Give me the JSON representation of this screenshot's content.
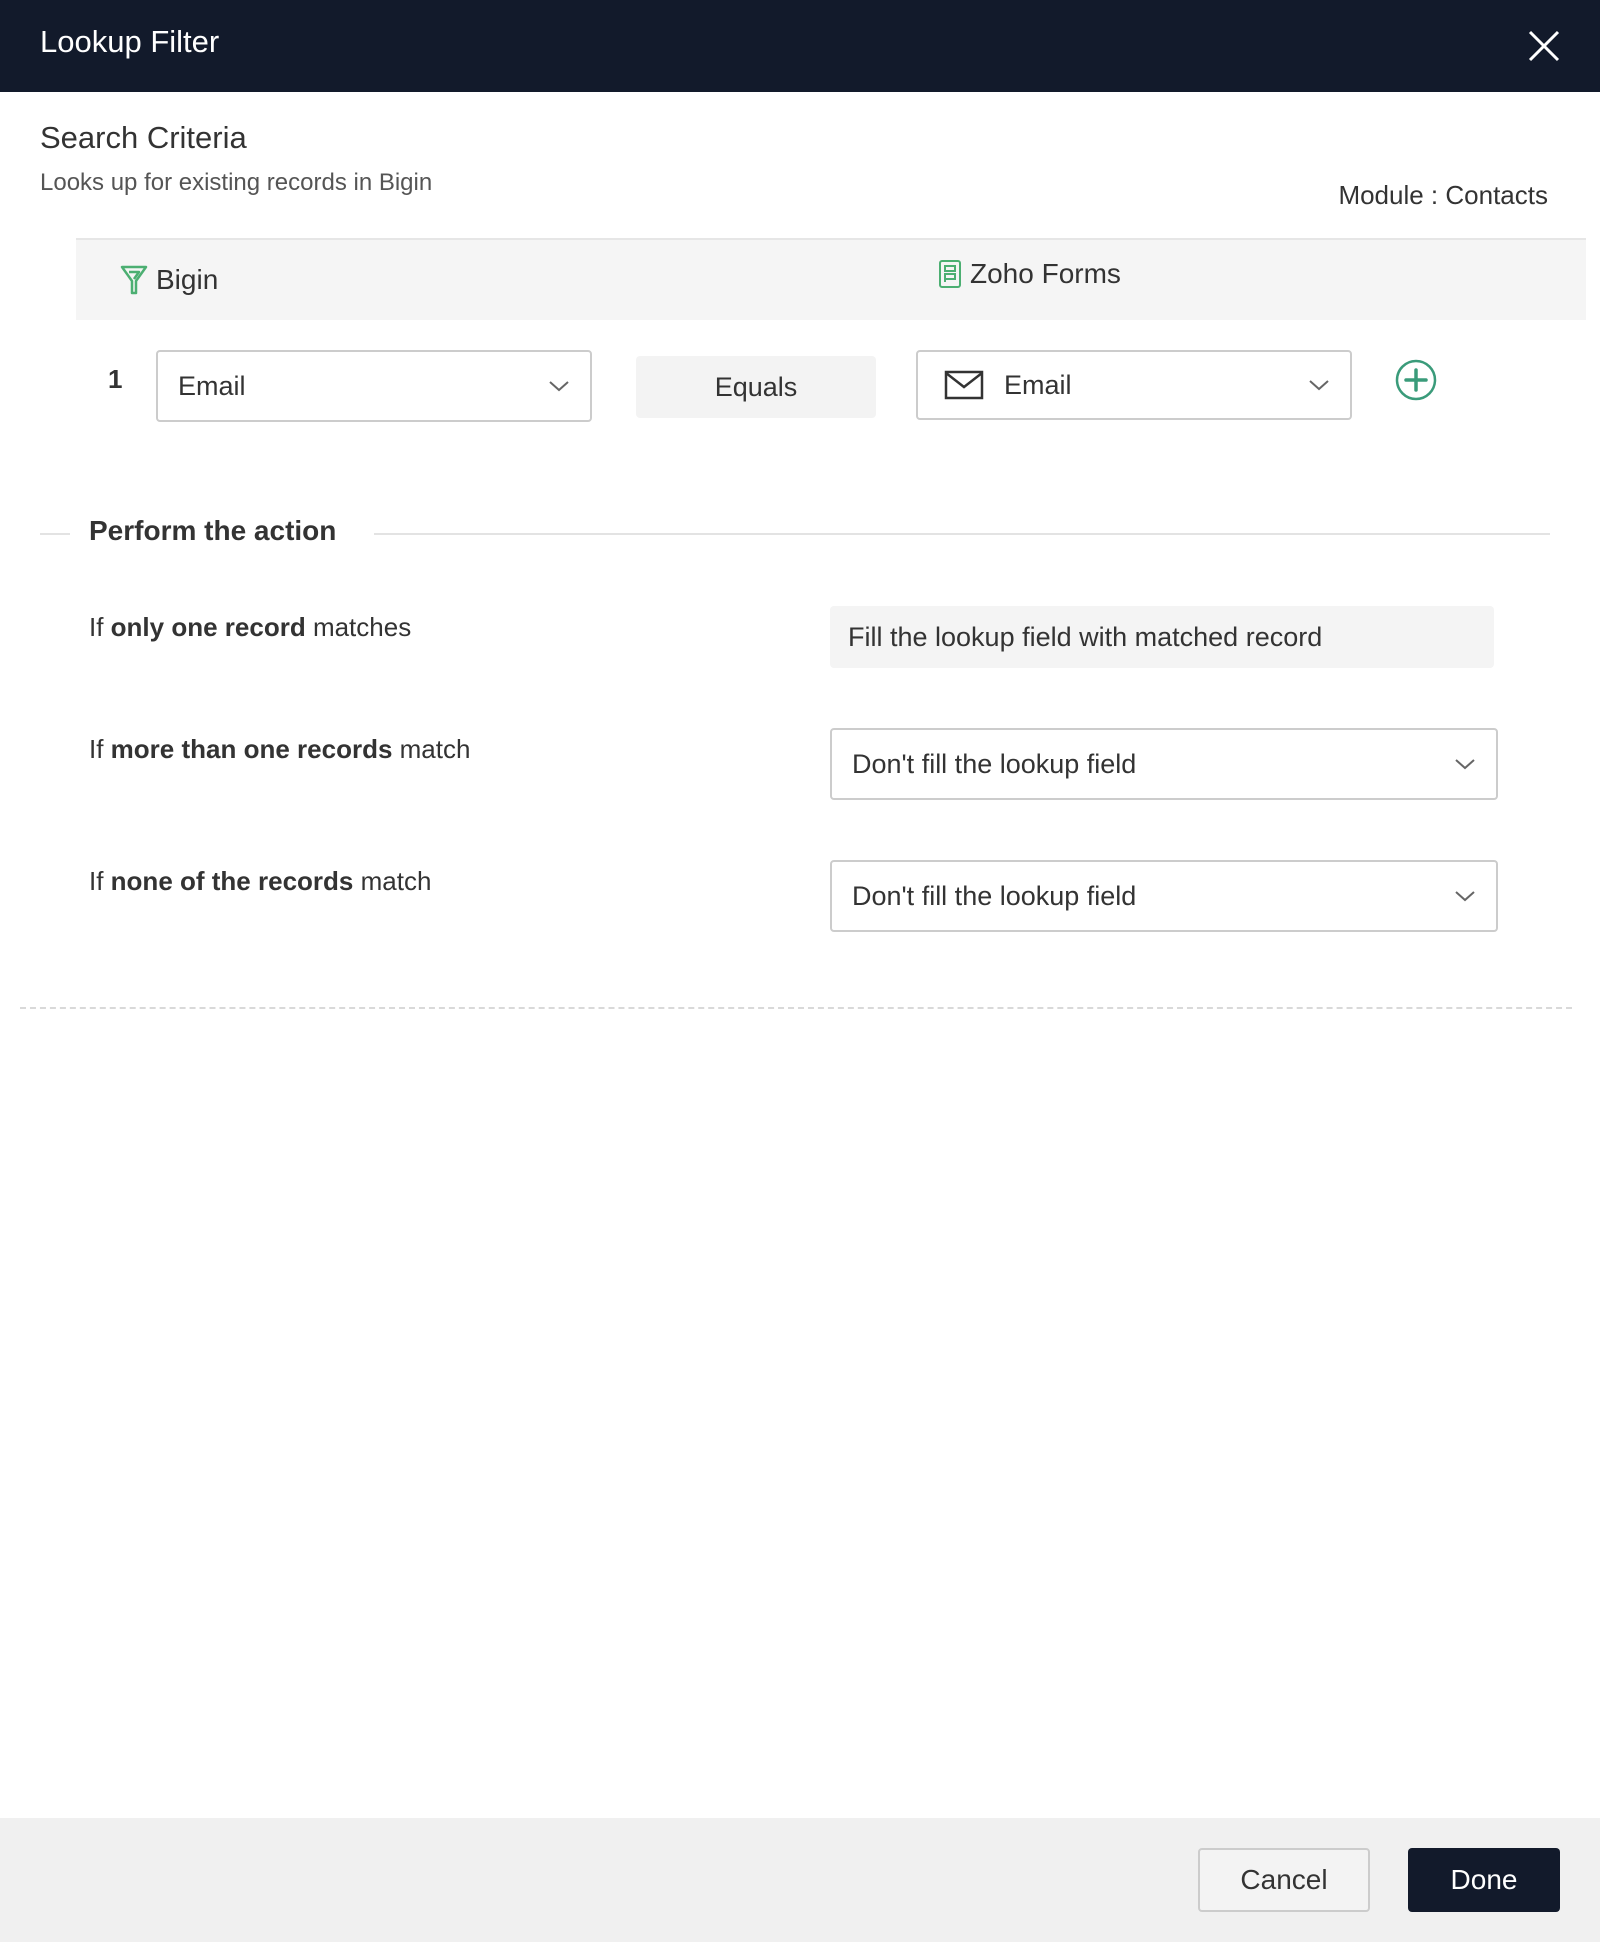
{
  "dialog": {
    "title": "Lookup Filter",
    "close_icon": "close-icon"
  },
  "search_criteria": {
    "title": "Search Criteria",
    "subtitle": "Looks up for existing records in Bigin",
    "module_label": "Module : Contacts"
  },
  "mapping": {
    "columns": [
      {
        "label": "Bigin",
        "icon": "bigin-logo-icon"
      },
      {
        "label": "Zoho Forms",
        "icon": "zoho-forms-icon"
      }
    ],
    "rows": [
      {
        "index": "1",
        "bigin_field": "Email",
        "operator": "Equals",
        "forms_field": "Email",
        "forms_field_icon": "envelope-icon"
      }
    ],
    "add_icon": "plus-circle-icon"
  },
  "action": {
    "title": "Perform the action",
    "conditions": [
      {
        "prefix": "If ",
        "bold": "only one record",
        "suffix": " matches",
        "value": "Fill the lookup field with matched record",
        "editable": false
      },
      {
        "prefix": "If ",
        "bold": "more than one records",
        "suffix": " match",
        "value": "Don't fill the lookup field",
        "editable": true
      },
      {
        "prefix": "If ",
        "bold": "none of the records",
        "suffix": " match",
        "value": "Don't fill the lookup field",
        "editable": true
      }
    ]
  },
  "footer": {
    "cancel_label": "Cancel",
    "done_label": "Done"
  },
  "colors": {
    "header_bg": "#121a2b",
    "accent_green": "#3a9b7a",
    "bigin_green": "#4caf72"
  }
}
